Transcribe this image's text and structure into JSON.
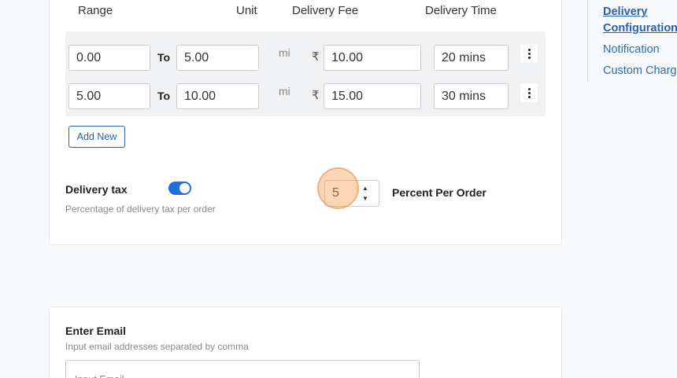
{
  "delivery_table": {
    "headers": {
      "range": "Range",
      "unit": "Unit",
      "fee": "Delivery Fee",
      "time": "Delivery Time"
    },
    "to_label": "To",
    "currency_symbol": "₹",
    "rows": [
      {
        "from": "0.00",
        "to": "5.00",
        "unit": "mi",
        "fee": "10.00",
        "time": "20 mins"
      },
      {
        "from": "5.00",
        "to": "10.00",
        "unit": "mi",
        "fee": "15.00",
        "time": "30 mins"
      }
    ],
    "add_new_label": "Add New"
  },
  "delivery_tax": {
    "title": "Delivery tax",
    "subtitle": "Percentage of delivery tax per order",
    "enabled": true,
    "value": "5",
    "suffix": "Percent Per Order"
  },
  "email_section": {
    "title": "Enter Email",
    "subtitle": "Input email addresses separated by comma",
    "placeholder": "Input Email"
  },
  "side_nav": {
    "items": [
      {
        "label": "Delivery",
        "active": true
      },
      {
        "label": "Configuration",
        "active": true
      },
      {
        "label": "Notification",
        "active": false
      },
      {
        "label": "Custom Charges",
        "active": false
      }
    ]
  },
  "colors": {
    "accent": "#1f6fe0",
    "link": "#2b6cb0",
    "highlight": "#f4a460"
  }
}
